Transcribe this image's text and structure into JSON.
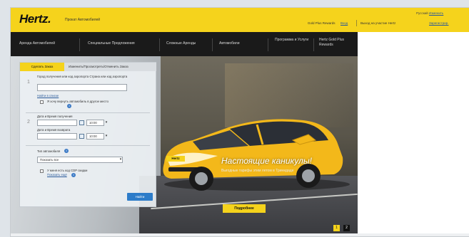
{
  "header": {
    "logo": "Hertz.",
    "tagline": "Прокат Автомобилей",
    "gold_text": "Gold Plus Rewards",
    "gold_link": "Вход",
    "exit_text": "Выход на участие Hertz",
    "exit_link": "Зарегистрир.",
    "lang_text": "Русский",
    "lang_link": "Изменить"
  },
  "nav": {
    "items": [
      {
        "label": "Аренда Автомобилей"
      },
      {
        "label": "Специальные Предложения"
      },
      {
        "label": "Сложные Аренды"
      },
      {
        "label": "Автомобили"
      },
      {
        "label": "Программа и Услуги"
      },
      {
        "label": "Hertz Gold Plus Rewards"
      }
    ]
  },
  "hero": {
    "title": "Настоящие каникулы!",
    "subtitle": "Выгодные тарифы этим летом в Тринидаде",
    "button": "Подробнее",
    "car_plate": "Hertz",
    "pager": [
      "1",
      "2"
    ],
    "colors": {
      "car": "#f3b81a",
      "accent": "#f5d31c"
    }
  },
  "booking": {
    "tabs": [
      "Сделать Заказ",
      "Изменить/Просмотреть/Отменить Заказ"
    ],
    "step1_label": "Город получения или код аэропорта",
    "step1_hint": "Страна или код аэропорта",
    "step1_value": "",
    "step1_link": "Найти в списке",
    "return_check_label": "Я хочу вернуть автомобиль в другое место",
    "pickup_label": "Дата и Время получения",
    "pickup_time": "10:00",
    "return_label": "Дата и Время возврата",
    "return_time": "10:00",
    "car_type_label": "Тип автомобиля",
    "car_type_value": "Показать все",
    "discount_label": "У меня есть код CDP скидки",
    "discount_link": "Показать ещё",
    "search_button": "Найти"
  }
}
